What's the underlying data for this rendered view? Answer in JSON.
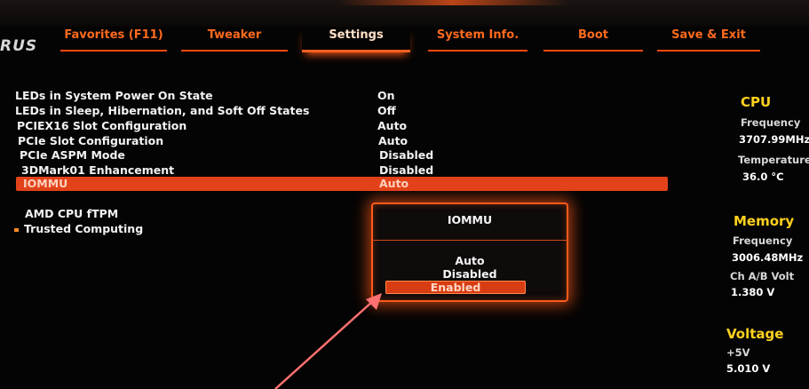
{
  "brand": "RUS",
  "nav": {
    "tabs": [
      {
        "label": "Favorites (F11)",
        "active": false
      },
      {
        "label": "Tweaker",
        "active": false
      },
      {
        "label": "Settings",
        "active": true
      },
      {
        "label": "System Info.",
        "active": false
      },
      {
        "label": "Boot",
        "active": false
      },
      {
        "label": "Save & Exit",
        "active": false
      }
    ]
  },
  "settings": {
    "rows": [
      {
        "label": "LEDs in System Power On State",
        "value": "On"
      },
      {
        "label": "LEDs in Sleep, Hibernation, and Soft Off States",
        "value": "Off"
      },
      {
        "label": "PCIEX16 Slot Configuration",
        "value": "Auto"
      },
      {
        "label": "PCIe Slot Configuration",
        "value": "Auto"
      },
      {
        "label": "PCIe ASPM Mode",
        "value": "Disabled"
      },
      {
        "label": "3DMark01 Enhancement",
        "value": "Disabled"
      },
      {
        "label": "IOMMU",
        "value": "Auto"
      }
    ],
    "extra": [
      {
        "label": "AMD CPU fTPM"
      },
      {
        "label": "Trusted Computing"
      }
    ]
  },
  "popup": {
    "title": "IOMMU",
    "options": [
      "Auto",
      "Disabled",
      "Enabled"
    ],
    "selected": "Enabled"
  },
  "panel": {
    "cpu": {
      "heading": "CPU",
      "freq_label": "Frequency",
      "freq_value": "3707.99MHz",
      "temp_label": "Temperature",
      "temp_value": "36.0 °C"
    },
    "memory": {
      "heading": "Memory",
      "freq_label": "Frequency",
      "freq_value": "3006.48MHz",
      "volt_label": "Ch A/B Volt",
      "volt_value": "1.380 V"
    },
    "voltage": {
      "heading": "Voltage",
      "rail_label": "+5V",
      "rail_value": "5.010 V"
    }
  },
  "colors": {
    "accent": "#ff5a1a",
    "highlight": "#e2421a",
    "panel_heading": "#ffd21e",
    "background": "#050404"
  }
}
